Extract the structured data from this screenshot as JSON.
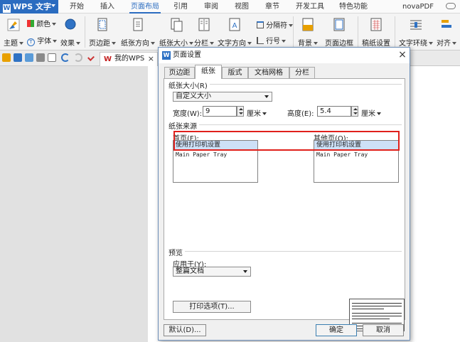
{
  "app": {
    "name": "WPS 文字",
    "menu_tabs": [
      "开始",
      "插入",
      "页面布局",
      "引用",
      "审阅",
      "视图",
      "章节",
      "开发工具",
      "特色功能",
      "novaPDF"
    ],
    "active_tab": "页面布局"
  },
  "ribbon": {
    "theme": "主题",
    "colors": "颜色",
    "fonts": "字体",
    "effects": "效果",
    "margins": "页边距",
    "orientation": "纸张方向",
    "size": "纸张大小",
    "columns": "分栏",
    "text_direction": "文字方向",
    "breaks": "分隔符",
    "line_numbers": "行号",
    "background": "背景",
    "page_border": "页面边框",
    "manuscript": "稿纸设置",
    "text_wrap": "文字环绕",
    "align": "对齐"
  },
  "doc_tab": {
    "label": "我的WPS",
    "close": "×"
  },
  "dialog": {
    "title": "页面设置",
    "close": "×",
    "tabs": [
      "页边距",
      "纸张",
      "版式",
      "文档网格",
      "分栏"
    ],
    "active_tab": "纸张",
    "paper_size_group": "纸张大小(R)",
    "paper_size_value": "自定义大小",
    "width_label": "宽度(W):",
    "width_value": "9",
    "width_unit": "厘米",
    "height_label": "高度(E):",
    "height_value": "5.4",
    "height_unit": "厘米",
    "paper_source_group": "纸张来源",
    "first_page_label": "首页(F):",
    "other_pages_label": "其他页(O):",
    "first_page_options": [
      "使用打印机设置",
      "Main Paper Tray"
    ],
    "other_pages_options": [
      "使用打印机设置",
      "Main Paper Tray"
    ],
    "preview_group": "预览",
    "apply_to_label": "应用于(Y):",
    "apply_to_value": "整篇文档",
    "print_options": "打印选项(T)...",
    "default_button": "默认(D)...",
    "ok_button": "确定",
    "cancel_button": "取消"
  }
}
